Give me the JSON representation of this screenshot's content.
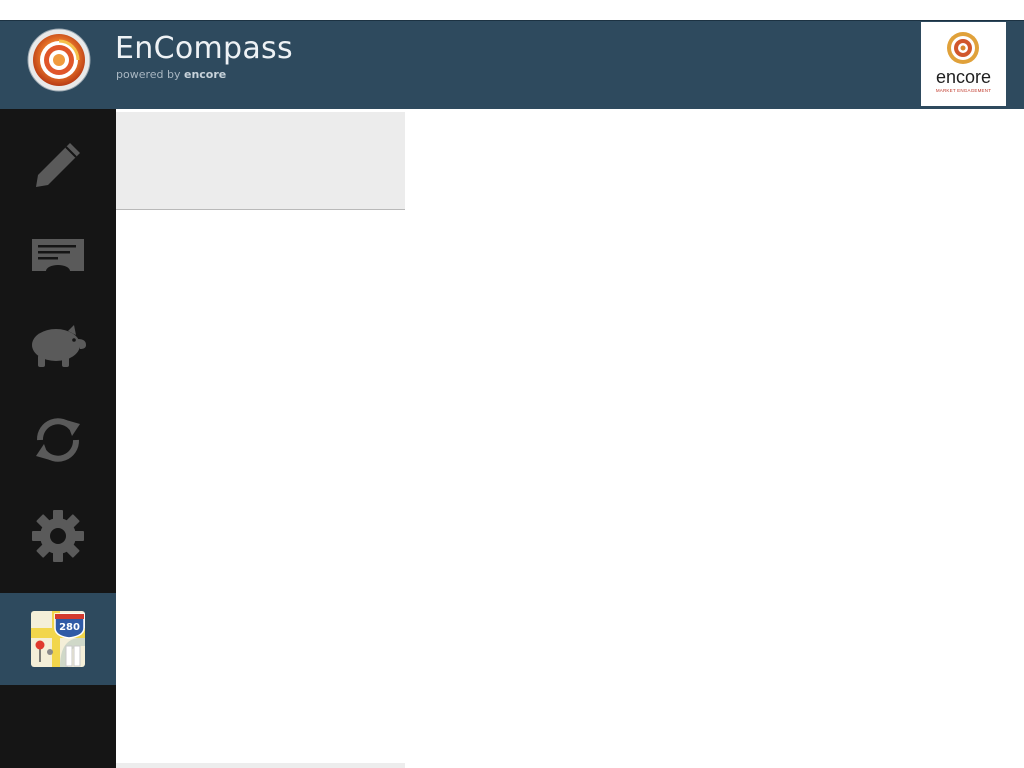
{
  "header": {
    "title": "EnCompass",
    "subtitle_prefix": "powered by",
    "subtitle_brand": "encore",
    "partner_logo": {
      "name": "encore",
      "tagline": "MARKET ENGAGEMENT"
    }
  },
  "sidebar": {
    "items": [
      {
        "icon": "pencil-icon"
      },
      {
        "icon": "ticket-icon"
      },
      {
        "icon": "piggy-bank-icon"
      },
      {
        "icon": "sync-icon"
      },
      {
        "icon": "gear-icon"
      },
      {
        "icon": "maps-icon",
        "badge": "280",
        "active": true
      }
    ]
  },
  "colors": {
    "header_bg": "#2e4a5e",
    "sidebar_bg": "#151515",
    "active_item_bg": "#2e4a5e",
    "icon_gray": "#5a5a5a",
    "panel_top_bg": "#ececec"
  }
}
